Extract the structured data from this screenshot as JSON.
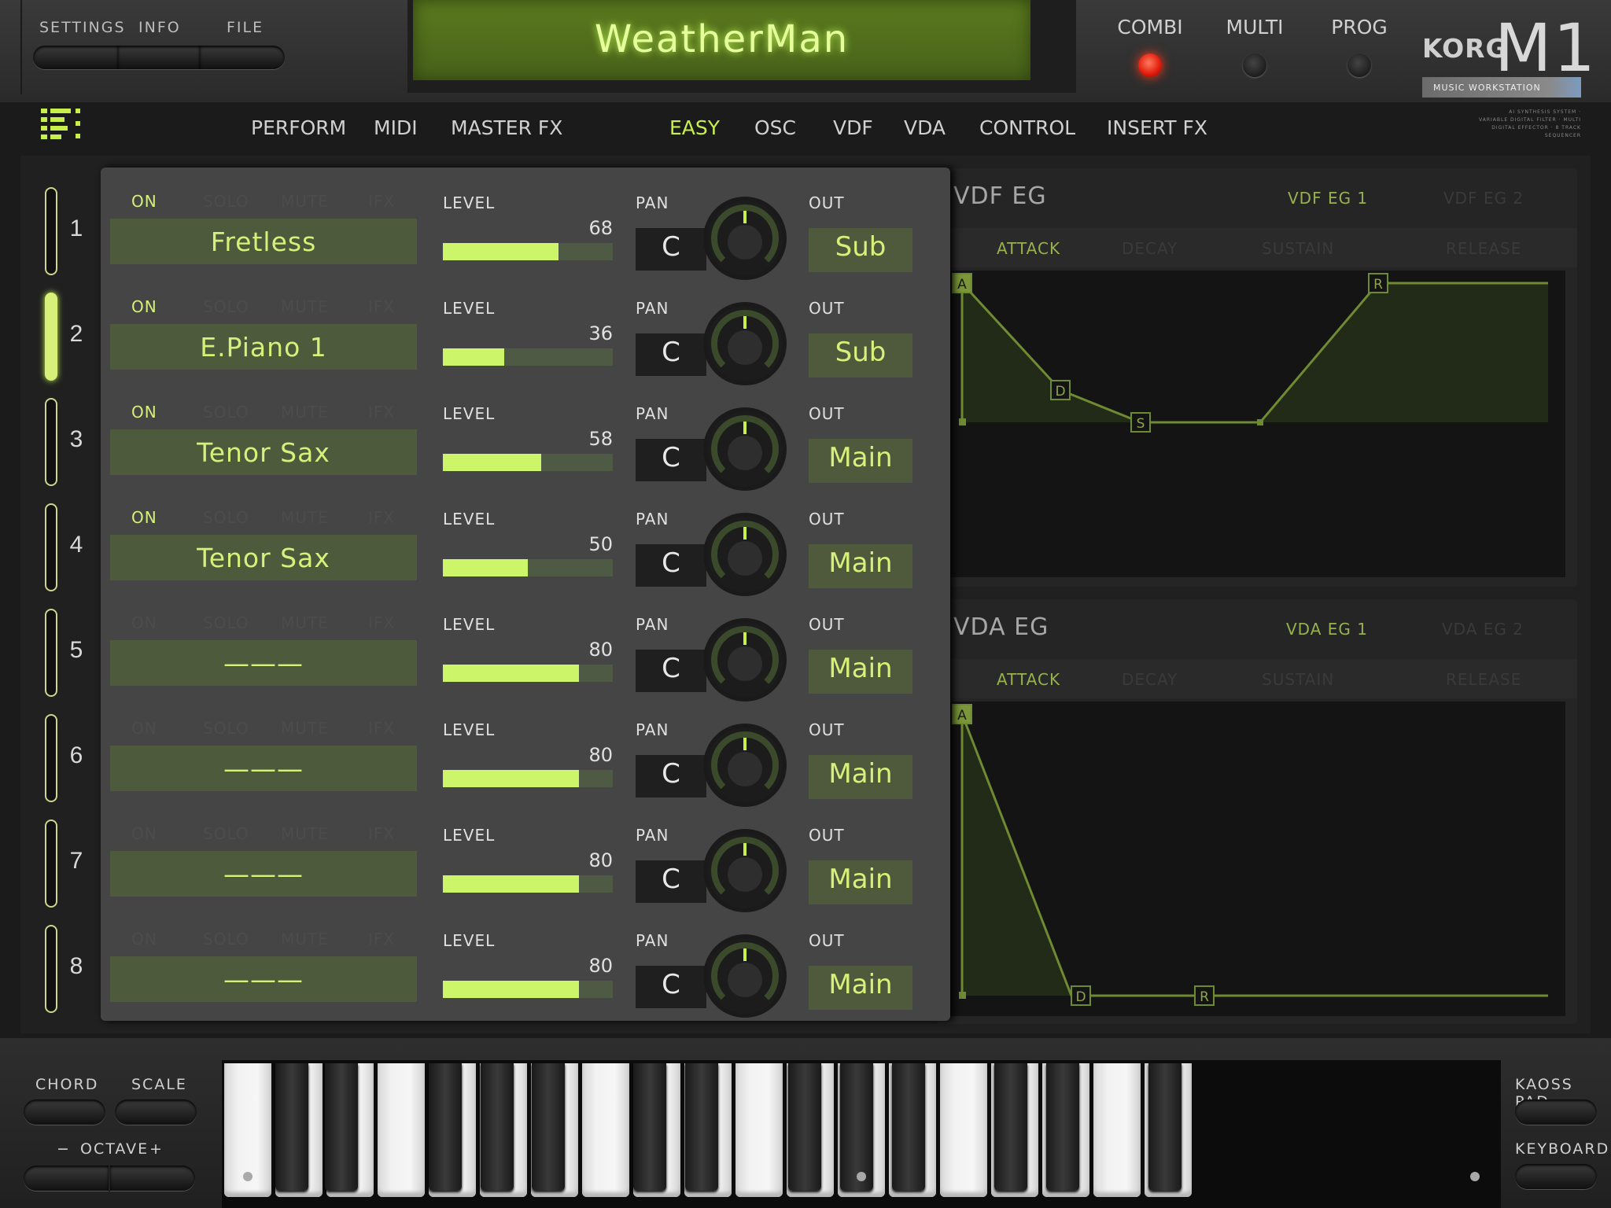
{
  "top": {
    "settings_label": "SETTINGS",
    "info_label": "INFO",
    "file_label": "FILE",
    "title": "WeatherMan",
    "modes": [
      {
        "label": "COMBI",
        "active": true
      },
      {
        "label": "MULTI",
        "active": false
      },
      {
        "label": "PROG",
        "active": false
      }
    ],
    "brand": "KORG",
    "model": "M1",
    "badge": "MUSIC WORKSTATION",
    "subtext": "AI SYNTHESIS SYSTEM · VARIABLE DIGITAL FILTER · MULTI DIGITAL EFFECTOR · 8 TRACK SEQUENCER"
  },
  "nav": {
    "items": [
      {
        "label": "PERFORM",
        "active": false
      },
      {
        "label": "MIDI",
        "active": false
      },
      {
        "label": "MASTER FX",
        "active": false
      },
      {
        "label": "EASY",
        "active": true
      },
      {
        "label": "OSC",
        "active": false
      },
      {
        "label": "VDF",
        "active": false
      },
      {
        "label": "VDA",
        "active": false
      },
      {
        "label": "CONTROL",
        "active": false
      },
      {
        "label": "INSERT FX",
        "active": false
      }
    ]
  },
  "labels": {
    "on": "ON",
    "solo": "SOLO",
    "mute": "MUTE",
    "ifx": "IFX",
    "level": "LEVEL",
    "pan": "PAN",
    "out": "OUT"
  },
  "timbres": [
    {
      "num": "1",
      "selected": false,
      "on": true,
      "program": "Fretless",
      "level": 68,
      "pan": "C",
      "out": "Sub"
    },
    {
      "num": "2",
      "selected": true,
      "on": true,
      "program": "E.Piano 1",
      "level": 36,
      "pan": "C",
      "out": "Sub"
    },
    {
      "num": "3",
      "selected": false,
      "on": true,
      "program": "Tenor Sax",
      "level": 58,
      "pan": "C",
      "out": "Main"
    },
    {
      "num": "4",
      "selected": false,
      "on": true,
      "program": "Tenor Sax",
      "level": 50,
      "pan": "C",
      "out": "Main"
    },
    {
      "num": "5",
      "selected": false,
      "on": false,
      "program": "———",
      "level": 80,
      "pan": "C",
      "out": "Main"
    },
    {
      "num": "6",
      "selected": false,
      "on": false,
      "program": "———",
      "level": 80,
      "pan": "C",
      "out": "Main"
    },
    {
      "num": "7",
      "selected": false,
      "on": false,
      "program": "———",
      "level": 80,
      "pan": "C",
      "out": "Main"
    },
    {
      "num": "8",
      "selected": false,
      "on": false,
      "program": "———",
      "level": 80,
      "pan": "C",
      "out": "Main"
    }
  ],
  "vdf_eg": {
    "title": "VDF EG",
    "tab_active": "VDF EG 1",
    "tab_inactive": "VDF EG 2",
    "stages": [
      {
        "label": "ATTACK",
        "active": true
      },
      {
        "label": "DECAY",
        "active": false
      },
      {
        "label": "SUSTAIN",
        "active": false
      },
      {
        "label": "RELEASE",
        "active": false
      }
    ],
    "points": [
      "A",
      "D",
      "S",
      "R"
    ]
  },
  "vda_eg": {
    "title": "VDA EG",
    "tab_active": "VDA EG 1",
    "tab_inactive": "VDA EG 2",
    "stages": [
      {
        "label": "ATTACK",
        "active": true
      },
      {
        "label": "DECAY",
        "active": false
      },
      {
        "label": "SUSTAIN",
        "active": false
      },
      {
        "label": "RELEASE",
        "active": false
      }
    ],
    "points": [
      "A",
      "D",
      "R"
    ]
  },
  "bottom": {
    "chord_label": "CHORD",
    "scale_label": "SCALE",
    "octave_minus": "−",
    "octave_label": "OCTAVE",
    "octave_plus": "+",
    "kaoss_label": "KAOSS PAD",
    "keyboard_label": "KEYBOARD"
  },
  "colors": {
    "accent": "#c7f04c",
    "lcd": "#5b7a1e",
    "led_on": "#ff3a1a",
    "eg_line": "#6e8a32"
  }
}
